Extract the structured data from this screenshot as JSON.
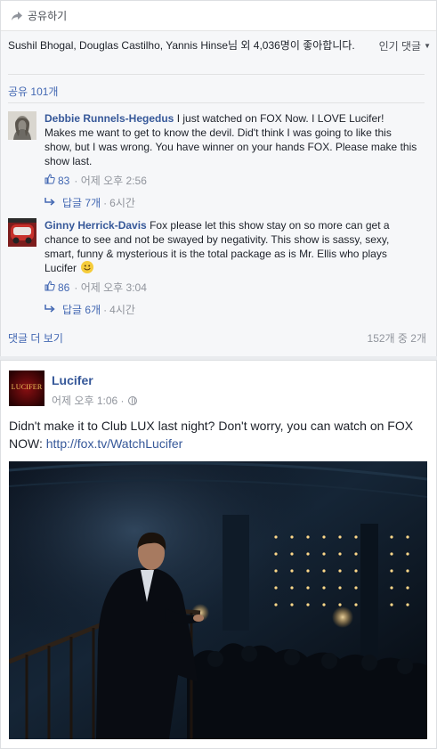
{
  "share": {
    "label": "공유하기",
    "icon": "share-arrow-icon"
  },
  "likes": {
    "text": "Sushil Bhogal, Douglas Castilho, Yannis Hinse님 외 4,036명이 좋아합니다.",
    "sort_label": "인기 댓글"
  },
  "shares": {
    "label": "공유 101개"
  },
  "comments": [
    {
      "author": "Debbie Runnels-Hegedus",
      "text": "I just watched on FOX Now. I LOVE Lucifer! Makes me want to get to know the devil. Did't think I was going to like this show, but I was wrong. You have winner on your hands FOX. Please make this show last.",
      "likes": "83",
      "time": "어제 오후 2:56",
      "replies": "답글 7개",
      "reply_time": "6시간"
    },
    {
      "author": "Ginny Herrick-Davis",
      "text": "Fox please let this show stay on so more can get a chance to see and not be swayed by negativity. This show is sassy, sexy, smart, funny & mysterious it is the total package as is Mr. Ellis who plays Lucifer",
      "likes": "86",
      "time": "어제 오후 3:04",
      "replies": "답글 6개",
      "reply_time": "4시간"
    }
  ],
  "more_comments": {
    "label": "댓글 더 보기",
    "pager": "152개 중 2개"
  },
  "post": {
    "page_name": "Lucifer",
    "avatar_text": "LUCIFER",
    "time": "어제 오후 1:06 ·",
    "text": "Didn't make it to Club LUX last night? Don't worry, you can watch on FOX NOW: ",
    "link": "http://fox.tv/WatchLucifer"
  },
  "colors": {
    "link": "#365899",
    "accent": "#4267b2",
    "muted": "#90949c",
    "ufi_bg": "#f6f7f9"
  }
}
